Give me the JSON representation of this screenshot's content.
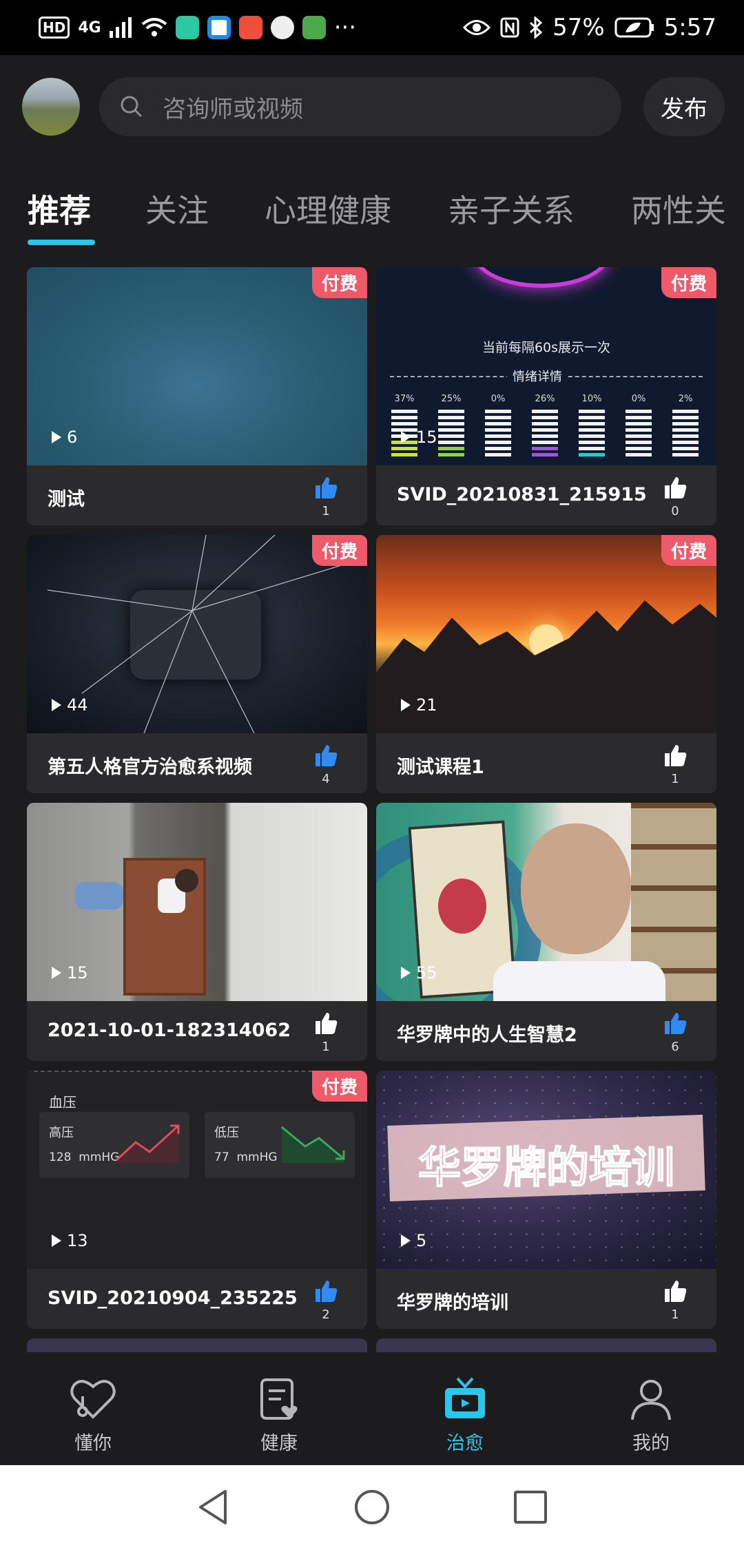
{
  "status_bar": {
    "hd": "HD",
    "network": "4G",
    "more": "···",
    "battery": "57%",
    "time": "5:57"
  },
  "header": {
    "search_placeholder": "咨询师或视频",
    "publish_label": "发布"
  },
  "tabs": [
    "推荐",
    "关注",
    "心理健康",
    "亲子关系",
    "两性关"
  ],
  "paid_badge": "付费",
  "cards": [
    {
      "title": "测试",
      "plays": "6",
      "likes": "1",
      "paid": true,
      "liked": true
    },
    {
      "title": "SVID_20210831_215915",
      "plays": "15",
      "likes": "0",
      "paid": true,
      "liked": false,
      "overlay": {
        "caption": "当前每隔60s展示一次",
        "section": "情绪详情",
        "percents": [
          "37%",
          "25%",
          "0%",
          "26%",
          "10%",
          "0%",
          "2%"
        ]
      }
    },
    {
      "title": "第五人格官方治愈系视频",
      "plays": "44",
      "likes": "4",
      "paid": true,
      "liked": true
    },
    {
      "title": "测试课程1",
      "plays": "21",
      "likes": "1",
      "paid": true,
      "liked": false
    },
    {
      "title": "2021-10-01-182314062",
      "plays": "15",
      "likes": "1",
      "paid": false,
      "liked": false
    },
    {
      "title": "华罗牌中的人生智慧2",
      "plays": "55",
      "likes": "6",
      "paid": false,
      "liked": true
    },
    {
      "title": "SVID_20210904_235225",
      "plays": "13",
      "likes": "2",
      "paid": true,
      "liked": true,
      "overlay": {
        "heading": "血压",
        "high_label": "高压",
        "high_value": "128",
        "low_label": "低压",
        "low_value": "77",
        "unit": "mmHG"
      }
    },
    {
      "title": "华罗牌的培训",
      "plays": "5",
      "likes": "1",
      "paid": false,
      "liked": false,
      "overlay": {
        "banner": "华罗牌的培训"
      }
    }
  ],
  "bottom_nav": [
    {
      "label": "懂你",
      "icon": "heart-icon"
    },
    {
      "label": "健康",
      "icon": "health-record-icon"
    },
    {
      "label": "治愈",
      "icon": "tv-icon",
      "active": true
    },
    {
      "label": "我的",
      "icon": "person-icon"
    }
  ],
  "colors": {
    "accent": "#2ec6e8",
    "paid_badge": "#ef5a6a",
    "like_active": "#2f8cf5",
    "background": "#1c1c1e"
  }
}
